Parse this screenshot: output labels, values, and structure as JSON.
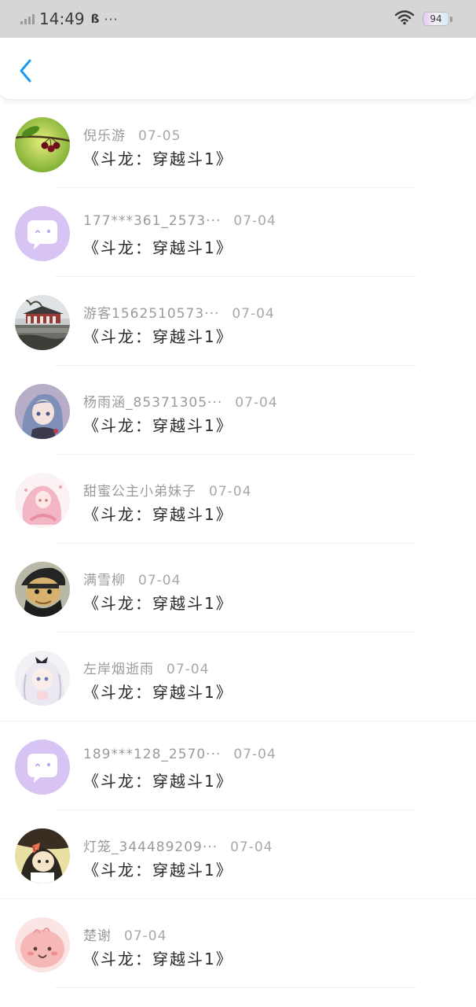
{
  "status_bar": {
    "time": "14:49",
    "notification": "ß",
    "more": "···",
    "battery": "94"
  },
  "header": {
    "back_icon": "chevron-left-icon",
    "accent_color": "#1e9bf0"
  },
  "items": [
    {
      "name": "倪乐游",
      "date": "07-05",
      "title": "《斗龙：穿越斗1》",
      "avatar": "cherries-avatar"
    },
    {
      "name": "177***361_2573···",
      "date": "07-04",
      "title": "《斗龙：穿越斗1》",
      "avatar": "default-chat-avatar"
    },
    {
      "name": "游客1562510573···",
      "date": "07-04",
      "title": "《斗龙：穿越斗1》",
      "avatar": "pavilion-photo-avatar"
    },
    {
      "name": "杨雨涵_85371305···",
      "date": "07-04",
      "title": "《斗龙：穿越斗1》",
      "avatar": "anime-girl-avatar"
    },
    {
      "name": "甜蜜公主小弟妹子",
      "date": "07-04",
      "title": "《斗龙：穿越斗1》",
      "avatar": "pink-anime-girl-avatar"
    },
    {
      "name": "满雪柳",
      "date": "07-04",
      "title": "《斗龙：穿越斗1》",
      "avatar": "cartoon-man-avatar"
    },
    {
      "name": "左岸烟逝雨",
      "date": "07-04",
      "title": "《斗龙：穿越斗1》",
      "avatar": "white-hair-girl-avatar"
    },
    {
      "name": "189***128_2570···",
      "date": "07-04",
      "title": "《斗龙：穿越斗1》",
      "avatar": "default-chat-avatar"
    },
    {
      "name": "灯笼_344489209···",
      "date": "07-04",
      "title": "《斗龙：穿越斗1》",
      "avatar": "cartoon-character-avatar"
    },
    {
      "name": "楚谢",
      "date": "07-04",
      "title": "《斗龙：穿越斗1》",
      "avatar": "pink-blob-avatar"
    }
  ]
}
